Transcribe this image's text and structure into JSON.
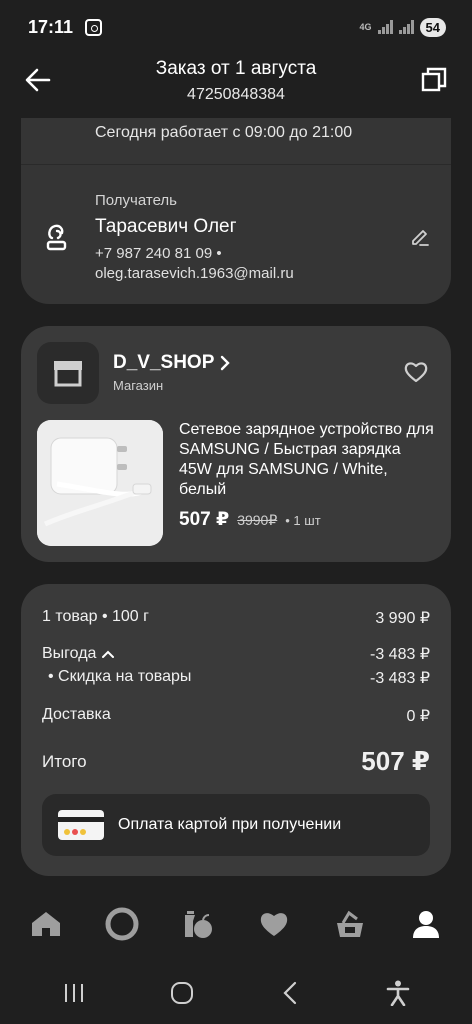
{
  "status_bar": {
    "time": "17:11",
    "network": "4G",
    "battery": "54"
  },
  "header": {
    "title": "Заказ от 1 августа",
    "subtitle": "47250848384"
  },
  "pickup": {
    "hours": "Сегодня работает с 09:00 до 21:00"
  },
  "recipient": {
    "label": "Получатель",
    "name": "Тарасевич Олег",
    "contacts": "+7 987 240 81 09 • oleg.tarasevich.1963@mail.ru"
  },
  "shop": {
    "name": "D_V_SHOP",
    "chevron": "›",
    "type": "Магазин",
    "product": {
      "title": "Сетевое зарядное устройство для SAMSUNG / Быстрая зарядка 45W для SAMSUNG / White, белый",
      "price": "507 ₽",
      "old_price": "3990₽",
      "quantity": "• 1 шт"
    }
  },
  "summary": {
    "items_label": "1 товар • 100 г",
    "items_value": "3 990 ₽",
    "benefit_label": "Выгода",
    "benefit_value": "-3 483 ₽",
    "discount_label": "•  Скидка на товары",
    "discount_value": "-3 483 ₽",
    "delivery_label": "Доставка",
    "delivery_value": "0 ₽",
    "total_label": "Итого",
    "total_value": "507 ₽",
    "payment": "Оплата картой при получении"
  },
  "tabbar": [
    "home-icon",
    "alice-icon",
    "catalog-icon",
    "favorites-icon",
    "cart-icon",
    "profile-icon"
  ],
  "colors": {
    "background": "#1f1f1f",
    "card": "#3a3a3a",
    "text": "#f2f2f2",
    "active_tab": "#ffffff",
    "inactive_tab": "#9e9e9e"
  }
}
